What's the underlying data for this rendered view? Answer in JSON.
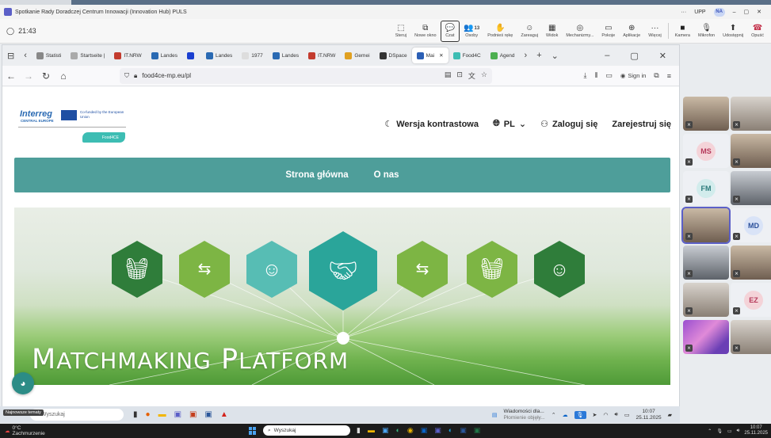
{
  "teams": {
    "window_title": "Spotkanie Rady Doradczej Centrum Innowacji (Innovation Hub) PULS",
    "org": "UPP",
    "user_initials": "NA",
    "timer": "21:43",
    "toolbar": [
      {
        "label": "Steruj",
        "icon": "⬚"
      },
      {
        "label": "Nowe okno",
        "icon": "⧉"
      },
      {
        "label": "Czat",
        "icon": "💬"
      },
      {
        "label": "Osoby",
        "icon": "👥",
        "count": "13"
      },
      {
        "label": "Podnieś rękę",
        "icon": "✋"
      },
      {
        "label": "Zareaguj",
        "icon": "☺"
      },
      {
        "label": "Widok",
        "icon": "▦"
      },
      {
        "label": "Mechanizmy...",
        "icon": "◎"
      },
      {
        "label": "Pokoje",
        "icon": "▭"
      },
      {
        "label": "Aplikacje",
        "icon": "⊕"
      },
      {
        "label": "Więcej",
        "icon": "···"
      }
    ],
    "controls": [
      {
        "label": "Kamera",
        "icon": "■"
      },
      {
        "label": "Mikrofon",
        "icon": "🎙"
      },
      {
        "label": "Udostępnij",
        "icon": "⬆"
      },
      {
        "label": "Opuść",
        "icon": "☎"
      }
    ]
  },
  "browser": {
    "tabs": [
      {
        "label": "Statisti",
        "color": "#888888"
      },
      {
        "label": "Startseite |",
        "color": "#aaaaaa"
      },
      {
        "label": "IT.NRW",
        "color": "#c33b2e"
      },
      {
        "label": "Landes",
        "color": "#2a6ab3"
      },
      {
        "label": "",
        "color": "#1a3fd0"
      },
      {
        "label": "Landes",
        "color": "#2a6ab3"
      },
      {
        "label": "1977",
        "color": "#dddddd"
      },
      {
        "label": "Landes",
        "color": "#2a6ab3"
      },
      {
        "label": "IT.NRW",
        "color": "#c33b2e"
      },
      {
        "label": "Gemei",
        "color": "#e0a020"
      },
      {
        "label": "DSpace",
        "color": "#333333"
      },
      {
        "label": "Mai",
        "color": "#2b5fb5",
        "active": true
      },
      {
        "label": "Food4C",
        "color": "#3dbdb3"
      },
      {
        "label": "Agend",
        "color": "#4caf50"
      }
    ],
    "url": "food4ce-mp.eu/pl",
    "sign_in": "Sign in"
  },
  "page": {
    "logo": {
      "interreg": "Interreg",
      "interreg_sub": "CENTRAL EUROPE",
      "cofunded": "Co-funded by the European Union",
      "project": "Food4CE"
    },
    "header": {
      "contrast": "Wersja kontrastowa",
      "language": "PL",
      "login": "Zaloguj się",
      "register": "Zarejestruj się"
    },
    "nav": [
      "Strona główna",
      "O nas"
    ],
    "hero": {
      "title_big1": "M",
      "title_small1": "ATCHMAKING",
      "title_big2": "P",
      "title_small2": "LATFORM"
    }
  },
  "participants": [
    {
      "initials": "",
      "video": true
    },
    {
      "initials": "",
      "video": true
    },
    {
      "initials": "MS",
      "color": "#f4d3d8",
      "text": "#b5395a"
    },
    {
      "initials": "",
      "video": true
    },
    {
      "initials": "FM",
      "color": "#d2ecec",
      "text": "#2a7a7a"
    },
    {
      "initials": "",
      "video": true
    },
    {
      "initials": "",
      "video": true,
      "selected": true
    },
    {
      "initials": "MD",
      "color": "#d9e3f7",
      "text": "#2a4f9a"
    },
    {
      "initials": "",
      "video": true
    },
    {
      "initials": "",
      "video": true
    },
    {
      "initials": "",
      "video": true
    },
    {
      "initials": "EZ",
      "color": "#f4d3d8",
      "text": "#b5395a"
    },
    {
      "initials": "",
      "video": true,
      "flowers": true
    },
    {
      "initials": "",
      "video": true
    }
  ],
  "remote_taskbar": {
    "search_placeholder": "Wyszukaj",
    "weather_tip": "Najnowsze tematy",
    "news_title": "Wiadomości dla...",
    "news_sub": "Płomienie objęły...",
    "time": "10:07",
    "date": "25.11.2025"
  },
  "local_taskbar": {
    "weather": "0°C",
    "weather_sub": "Zachmurzenie",
    "search_placeholder": "Wyszukaj",
    "time": "10:07",
    "date": "25.11.2025"
  },
  "colors": {
    "teal_nav": "#4e9e9a",
    "teams_accent": "#5b5fc7",
    "dark_green_hex": "#2f7d3a",
    "light_green_hex": "#7db544",
    "teal_hex": "#57bdb4"
  }
}
